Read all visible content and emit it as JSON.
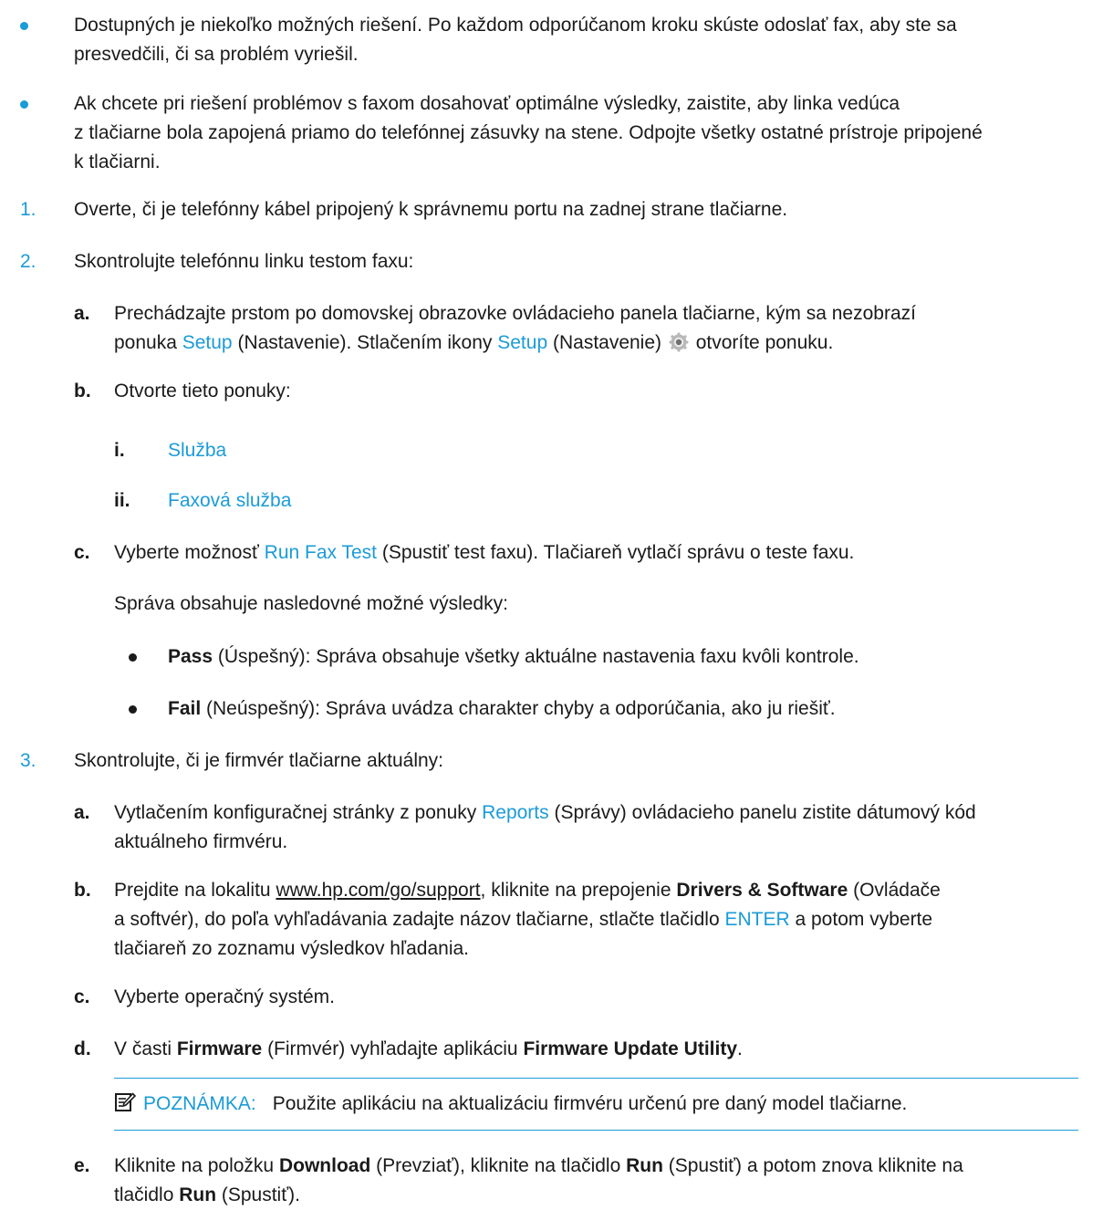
{
  "colors": {
    "accent": "#1b9bd7",
    "text": "#1a1a1a"
  },
  "intro_bullets": [
    {
      "l1": "Dostupných je niekoľko možných riešení. Po každom odporúčanom kroku skúste odoslať fax, aby ste sa",
      "l2": "presvedčili, či sa problém vyriešil."
    },
    {
      "l1": "Ak chcete pri riešení problémov s faxom dosahovať optimálne výsledky, zaistite, aby linka vedúca",
      "l2": "z tlačiarne bola zapojená priamo do telefónnej zásuvky na stene. Odpojte všetky ostatné prístroje pripojené",
      "l3": "k tlačiarni."
    }
  ],
  "step1": {
    "num": "1.",
    "text": "Overte, či je telefónny kábel pripojený k správnemu portu na zadnej strane tlačiarne."
  },
  "step2": {
    "num": "2.",
    "text": "Skontrolujte telefónnu linku testom faxu:",
    "a": {
      "letter": "a.",
      "l1": "Prechádzajte prstom po domovskej obrazovke ovládacieho panela tlačiarne, kým sa nezobrazí",
      "l2_pre": "ponuka ",
      "l2_link1": "Setup",
      "l2_mid": " (Nastavenie). Stlačením ikony ",
      "l2_link2": "Setup",
      "l2_mid2": " (Nastavenie) ",
      "l2_post": " otvoríte ponuku.",
      "icon": "gear-icon"
    },
    "b": {
      "letter": "b.",
      "text": "Otvorte tieto ponuky:",
      "items": [
        {
          "roman": "i.",
          "text": "Služba"
        },
        {
          "roman": "ii.",
          "text": "Faxová služba"
        }
      ]
    },
    "c": {
      "letter": "c.",
      "pre": "Vyberte možnosť ",
      "link": "Run Fax Test",
      "post": " (Spustiť test faxu). Tlačiareň vytlačí správu o teste faxu.",
      "para": "Správa obsahuje nasledovné možné výsledky:",
      "results": [
        {
          "bold": "Pass",
          "rest": " (Úspešný): Správa obsahuje všetky aktuálne nastavenia faxu kvôli kontrole."
        },
        {
          "bold": "Fail",
          "rest": " (Neúspešný): Správa uvádza charakter chyby a odporúčania, ako ju riešiť."
        }
      ]
    }
  },
  "step3": {
    "num": "3.",
    "text": "Skontrolujte, či je firmvér tlačiarne aktuálny:",
    "a": {
      "letter": "a.",
      "l1_pre": "Vytlačením konfiguračnej stránky z ponuky ",
      "l1_link": "Reports",
      "l1_post": " (Správy) ovládacieho panelu zistite dátumový kód",
      "l2": "aktuálneho firmvéru."
    },
    "b": {
      "letter": "b.",
      "l1_pre": "Prejdite na lokalitu ",
      "l1_url": "www.hp.com/go/support",
      "l1_mid": ", kliknite na prepojenie ",
      "l1_bold": "Drivers & Software",
      "l1_post": " (Ovládače",
      "l2_pre": "a softvér), do poľa vyhľadávania zadajte názov tlačiarne, stlačte tlačidlo ",
      "l2_link": "ENTER",
      "l2_post": " a potom vyberte",
      "l3": "tlačiareň zo zoznamu výsledkov hľadania."
    },
    "c": {
      "letter": "c.",
      "text": "Vyberte operačný systém."
    },
    "d": {
      "letter": "d.",
      "pre": "V časti ",
      "bold1": "Firmware",
      "mid": " (Firmvér) vyhľadajte aplikáciu ",
      "bold2": "Firmware Update Utility",
      "post": "."
    },
    "note": {
      "label": "POZNÁMKA:",
      "text": "Použite aplikáciu na aktualizáciu firmvéru určenú pre daný model tlačiarne.",
      "icon": "note-icon"
    },
    "e": {
      "letter": "e.",
      "pre": "Kliknite na položku ",
      "bold1": "Download",
      "mid1": " (Prevziať), kliknite na tlačidlo ",
      "bold2": "Run",
      "mid2": " (Spustiť) a potom znova kliknite na",
      "l2_pre": "tlačidlo ",
      "l2_bold": "Run",
      "l2_post": " (Spustiť)."
    }
  }
}
